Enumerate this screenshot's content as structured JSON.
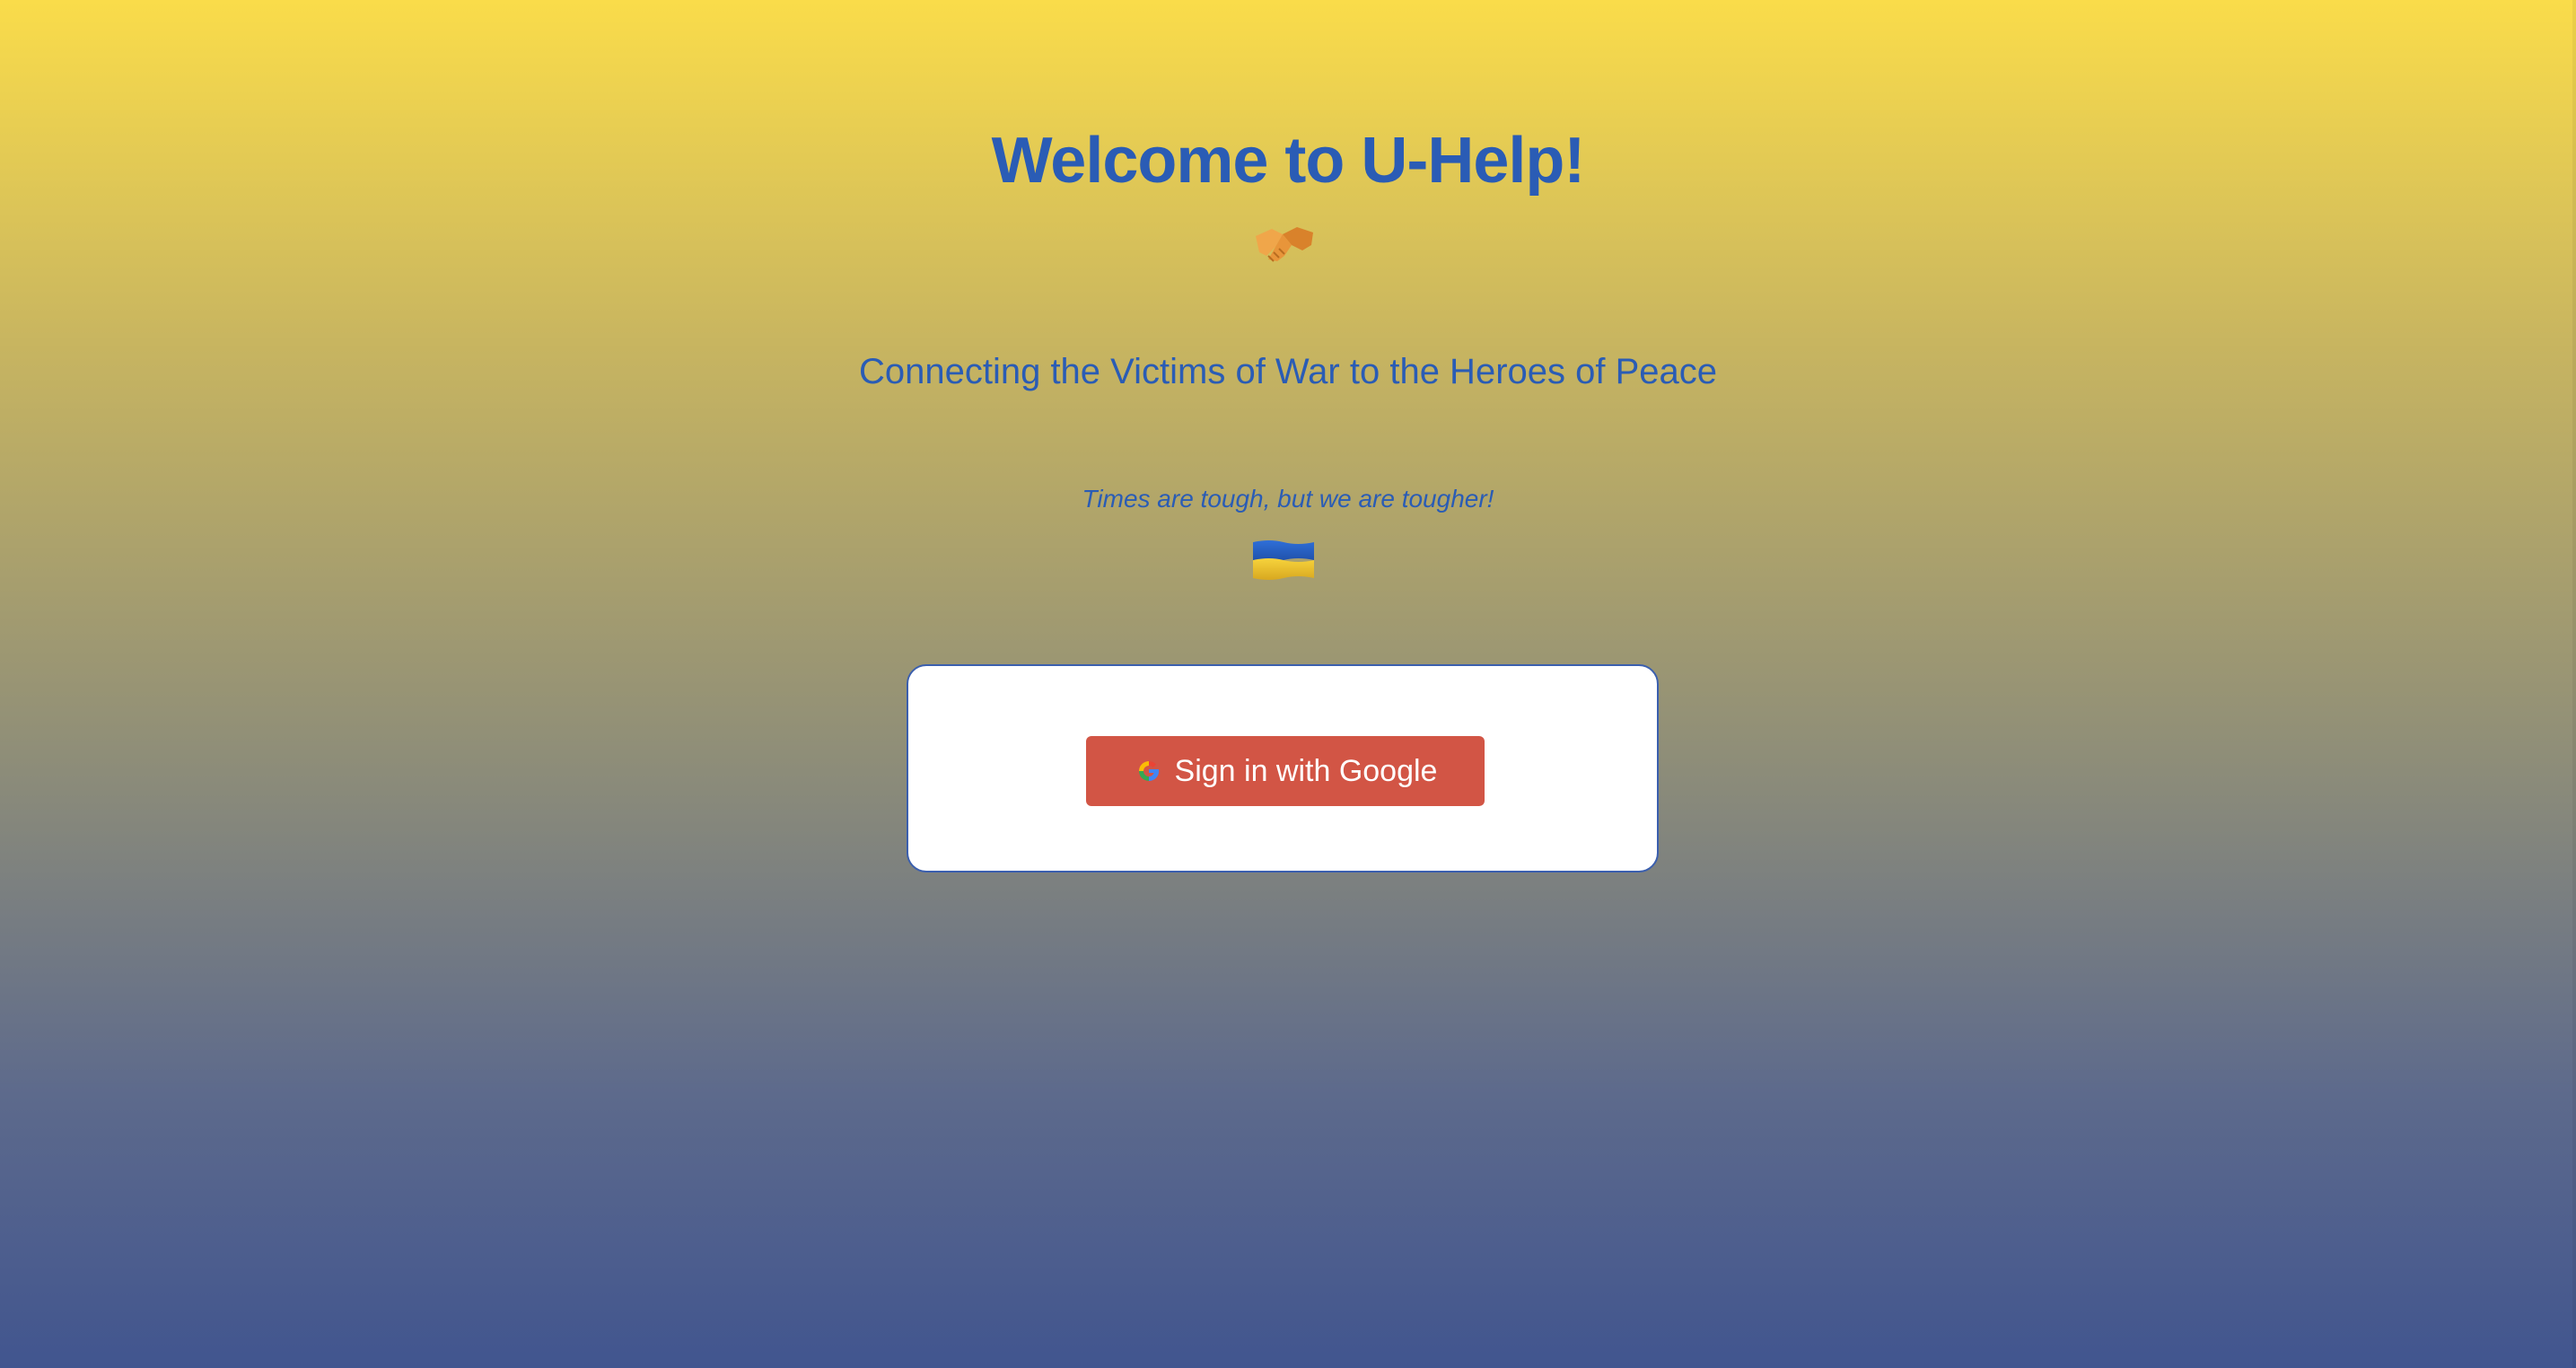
{
  "page": {
    "title": "Welcome to U-Help!",
    "subtitle": "Connecting the Victims of War to the Heroes of Peace",
    "tagline": "Times are tough, but we are tougher!"
  },
  "icons": {
    "handshake": "handshake-icon",
    "flag": "ukraine-flag-icon",
    "google": "google-icon"
  },
  "signin": {
    "button_label": "Sign in with Google"
  },
  "colors": {
    "text_blue": "#2a5cb5",
    "button_red": "#d25545",
    "gradient_top": "#fadc4a",
    "gradient_bottom": "#41558f"
  }
}
